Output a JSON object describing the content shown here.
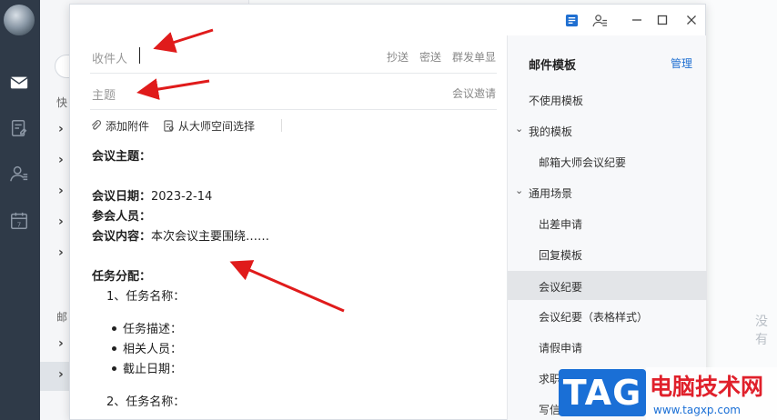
{
  "sidebar": {
    "icons": [
      "mail-icon",
      "note-icon",
      "contacts-icon",
      "calendar-icon"
    ],
    "calendar_day": "7"
  },
  "list": {
    "quick_label": "快",
    "mail_label": "邮"
  },
  "right_bg": {
    "empty_text": "没有"
  },
  "compose": {
    "to_label": "收件人",
    "cc": "抄送",
    "bcc": "密送",
    "group_single": "群发单显",
    "subject_label": "主题",
    "meeting_invite": "会议邀请",
    "attach": "添加附件",
    "from_space": "从大师空间选择",
    "body": {
      "topic": "会议主题：",
      "date_label": "会议日期：",
      "date_value": "2023-2-14",
      "attendees": "参会人员：",
      "content_label": "会议内容：",
      "content_value": "本次会议主要围绕……",
      "task_heading": "任务分配：",
      "task1": "1、任务名称：",
      "bullets": [
        "任务描述：",
        "相关人员：",
        "截止日期："
      ],
      "task2": "2、任务名称："
    }
  },
  "templates": {
    "title": "邮件模板",
    "manage": "管理",
    "no_template": "不使用模板",
    "my_templates": "我的模板",
    "my_items": [
      "邮箱大师会议纪要"
    ],
    "general": "通用场景",
    "general_items": [
      "出差申请",
      "回复模板",
      "会议纪要",
      "会议纪要（表格样式）",
      "请假申请",
      "求职",
      "写信"
    ],
    "active": "会议纪要"
  },
  "watermark": {
    "tag": "TAG",
    "cn": "电脑技术网",
    "url": "www.tagxp.com"
  },
  "colors": {
    "accent": "#1f6fd1",
    "arrow": "#e01b1b",
    "rail": "#2f3a48"
  }
}
